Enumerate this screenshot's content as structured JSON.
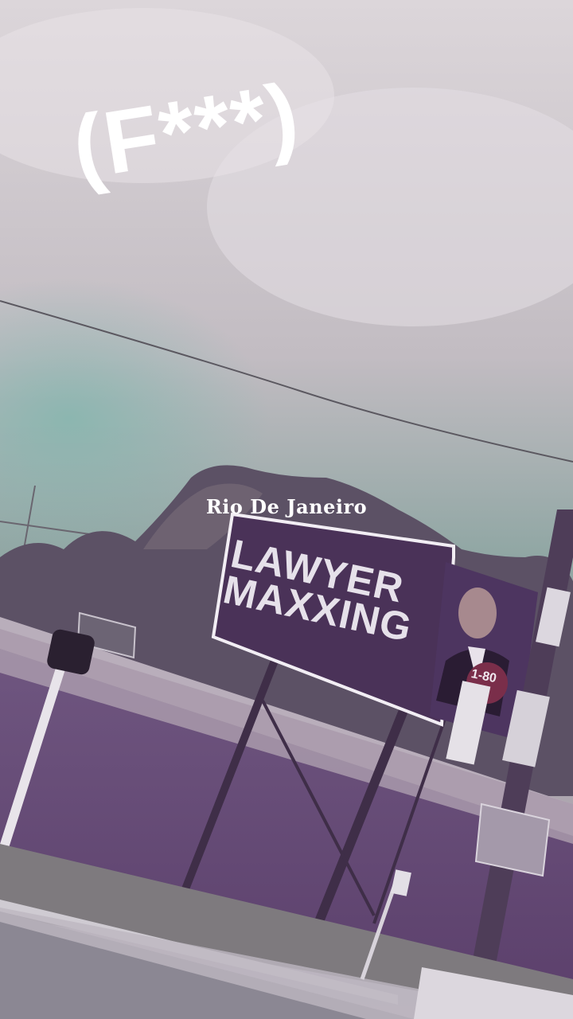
{
  "overlay": {
    "caption": "(F***)",
    "location_label": "Rio De Janeiro"
  },
  "billboard": {
    "line1": "LAWYER",
    "line2": "MAXXING",
    "phone_fragment": "1-80"
  },
  "colors": {
    "sky_top": "#d9d4d8",
    "sky_mid": "#9aa3a1",
    "sky_teal": "#7fb3ad",
    "tree": "#5f5466",
    "wall": "#6c4f7a",
    "wall_top": "#b7acb8",
    "billboard_panel": "#4a3258",
    "billboard_border": "#ffffff",
    "road": "#8f8c96",
    "grass": "#7d7a78"
  }
}
